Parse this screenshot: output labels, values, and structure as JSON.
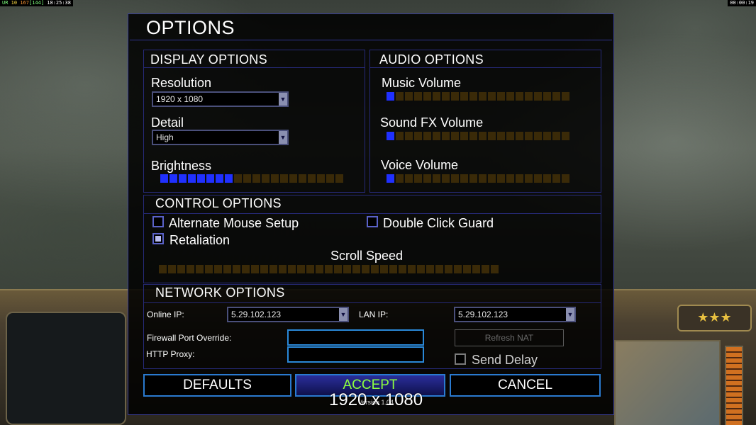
{
  "hud": {
    "left": {
      "a": "UR",
      "b": "10",
      "c": "167",
      "d": "[144]",
      "time": "18:25:38"
    },
    "right_time": "00:00:19"
  },
  "background_bar": {
    "rank_stars": "★★★"
  },
  "dialog": {
    "title": "OPTIONS",
    "display": {
      "title": "DISPLAY OPTIONS",
      "resolution_label": "Resolution",
      "resolution_value": "1920 x 1080",
      "detail_label": "Detail",
      "detail_value": "High",
      "brightness_label": "Brightness",
      "brightness_level": 8,
      "brightness_cells": 20
    },
    "audio": {
      "title": "AUDIO OPTIONS",
      "music_label": "Music Volume",
      "music_level": 1,
      "sfx_label": "Sound FX Volume",
      "sfx_level": 1,
      "voice_label": "Voice Volume",
      "voice_level": 1,
      "cells": 20
    },
    "control": {
      "title": "CONTROL OPTIONS",
      "alt_mouse_label": "Alternate Mouse Setup",
      "alt_mouse_checked": false,
      "double_click_label": "Double Click Guard",
      "double_click_checked": false,
      "retaliation_label": "Retaliation",
      "retaliation_checked": true,
      "scroll_label": "Scroll Speed",
      "scroll_level": 0,
      "scroll_cells": 37
    },
    "network": {
      "title": "NETWORK OPTIONS",
      "online_ip_label": "Online IP:",
      "online_ip_value": "5.29.102.123",
      "lan_ip_label": "LAN IP:",
      "lan_ip_value": "5.29.102.123",
      "firewall_label": "Firewall Port Override:",
      "firewall_value": "",
      "proxy_label": "HTTP Proxy:",
      "proxy_value": "",
      "refresh_nat_label": "Refresh NAT",
      "send_delay_label": "Send Delay",
      "send_delay_checked": false
    },
    "buttons": {
      "defaults": "DEFAULTS",
      "accept": "ACCEPT",
      "cancel": "CANCEL"
    },
    "version": "Version 1.04"
  },
  "resolution_overlay": "1920 x 1080",
  "colors": {
    "slider_on": "#2030ff",
    "slider_off": "#3a2a08",
    "accept_text": "#8cff40",
    "panel_border": "#3a3f9a"
  }
}
